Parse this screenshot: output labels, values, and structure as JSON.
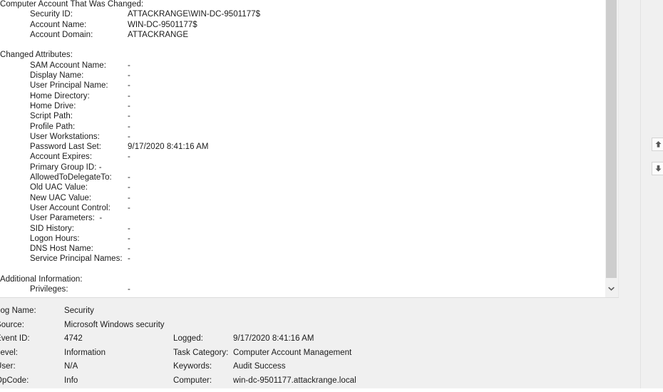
{
  "description": {
    "sections": [
      {
        "heading": "Computer Account That Was Changed:",
        "rows": [
          {
            "label": "Security ID:",
            "value": "ATTACKRANGE\\WIN-DC-9501177$",
            "inline": false
          },
          {
            "label": "Account Name:",
            "value": "WIN-DC-9501177$",
            "inline": false
          },
          {
            "label": "Account Domain:",
            "value": "ATTACKRANGE",
            "inline": false
          }
        ]
      },
      {
        "heading": "Changed Attributes:",
        "rows": [
          {
            "label": "SAM Account Name:",
            "value": "-",
            "inline": false
          },
          {
            "label": "Display Name:",
            "value": "-",
            "inline": false
          },
          {
            "label": "User Principal Name:",
            "value": "-",
            "inline": false
          },
          {
            "label": "Home Directory:",
            "value": "-",
            "inline": false
          },
          {
            "label": "Home Drive:",
            "value": "-",
            "inline": false
          },
          {
            "label": "Script Path:",
            "value": "-",
            "inline": false
          },
          {
            "label": "Profile Path:",
            "value": "-",
            "inline": false
          },
          {
            "label": "User Workstations:",
            "value": "-",
            "inline": false
          },
          {
            "label": "Password Last Set:",
            "value": "9/17/2020 8:41:16 AM",
            "inline": false
          },
          {
            "label": "Account Expires:",
            "value": "-",
            "inline": false
          },
          {
            "label": "Primary Group ID: ",
            "value": "-",
            "inline": true
          },
          {
            "label": "AllowedToDelegateTo:",
            "value": "-",
            "inline": false
          },
          {
            "label": "Old UAC Value:",
            "value": "-",
            "inline": false
          },
          {
            "label": "New UAC Value:",
            "value": "-",
            "inline": false
          },
          {
            "label": "User Account Control:",
            "value": "-",
            "inline": false
          },
          {
            "label": "User Parameters:  ",
            "value": "-",
            "inline": true
          },
          {
            "label": "SID History:",
            "value": "-",
            "inline": false
          },
          {
            "label": "Logon Hours:",
            "value": "-",
            "inline": false
          },
          {
            "label": "DNS Host Name:",
            "value": "-",
            "inline": false
          },
          {
            "label": "Service Principal Names:",
            "value": "-",
            "inline": false
          }
        ]
      },
      {
        "heading": "Additional Information:",
        "rows": [
          {
            "label": "Privileges:",
            "value": "-",
            "inline": false
          }
        ]
      }
    ]
  },
  "details": {
    "left": [
      {
        "label": "Log Name:",
        "value": "Security"
      },
      {
        "label": "Source:",
        "value": "Microsoft Windows security"
      },
      {
        "label": "Event ID:",
        "value": "4742"
      },
      {
        "label": "Level:",
        "value": "Information"
      },
      {
        "label": "User:",
        "value": "N/A"
      },
      {
        "label": "OpCode:",
        "value": "Info"
      }
    ],
    "right": [
      {
        "label": "Logged:",
        "value": "9/17/2020 8:41:16 AM"
      },
      {
        "label": "Task Category:",
        "value": "Computer Account Management"
      },
      {
        "label": "Keywords:",
        "value": "Audit Success"
      },
      {
        "label": "Computer:",
        "value": "win-dc-9501177.attackrange.local"
      }
    ]
  },
  "scrollbar": {
    "down_arrow_icon": "chevron-down-icon"
  },
  "right_pane": {
    "up_button_icon": "arrow-up-icon",
    "down_button_icon": "arrow-down-icon"
  },
  "colors": {
    "pane_background": "#ffffff",
    "chrome_background": "#f0f0f0",
    "text": "#1b1b1b",
    "scroll_thumb": "#cdcdcd",
    "divider": "#e2e2e2"
  }
}
